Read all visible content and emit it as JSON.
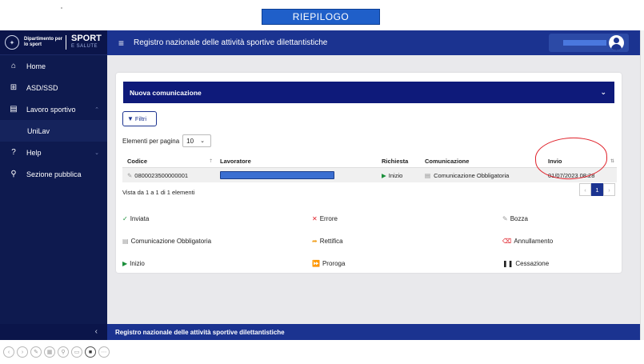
{
  "banner": {
    "title": "RIEPILOGO"
  },
  "logo": {
    "dept": "Dipartimento per lo sport",
    "sport": "SPORT",
    "salute": "E SALUTE"
  },
  "sidebar": {
    "items": [
      {
        "label": "Home",
        "icon": "home-icon",
        "glyph": "⌂"
      },
      {
        "label": "ASD/SSD",
        "icon": "sitemap-icon",
        "glyph": "⊞"
      },
      {
        "label": "Lavoro sportivo",
        "icon": "briefcase-icon",
        "glyph": "▤"
      },
      {
        "label": "UniLav",
        "icon": "",
        "glyph": ""
      },
      {
        "label": "Help",
        "icon": "help-icon",
        "glyph": "?"
      },
      {
        "label": "Sezione pubblica",
        "icon": "search-icon",
        "glyph": "⚲"
      }
    ],
    "collapse_glyph": "‹"
  },
  "header": {
    "title": "Registro nazionale delle attività sportive dilettantistiche"
  },
  "card": {
    "title": "Nuova comunicazione",
    "filter_label": "Filtri",
    "per_page_label": "Elementi per pagina",
    "per_page_value": "10"
  },
  "table": {
    "headers": {
      "codice": "Codice",
      "lavoratore": "Lavoratore",
      "richiesta": "Richiesta",
      "comunicazione": "Comunicazione",
      "invio": "Invio"
    },
    "rows": [
      {
        "codice": "0800023500000001",
        "richiesta": "Inizio",
        "comunicazione": "Comunicazione Obbligatoria",
        "invio": "01/07/2023 08:28"
      }
    ],
    "range_text": "Vista da 1 a 1 di 1 elementi",
    "pager": {
      "prev": "‹",
      "page": "1",
      "next": "›"
    }
  },
  "legend": {
    "inviata": "Inviata",
    "errore": "Errore",
    "bozza": "Bozza",
    "obbligatoria": "Comunicazione Obbligatoria",
    "rettifica": "Rettifica",
    "annullamento": "Annullamento",
    "inizio": "Inizio",
    "proroga": "Proroga",
    "cessazione": "Cessazione"
  },
  "colors": {
    "sidebar": "#0e1a4f",
    "header": "#1b3390",
    "accent_green": "#1a8f3a",
    "error_red": "#e0212a",
    "proroga_purple": "#7b2bd6",
    "rettifica_orange": "#f0a020"
  },
  "footer": {
    "title": "Registro nazionale delle attività sportive dilettantistiche"
  }
}
